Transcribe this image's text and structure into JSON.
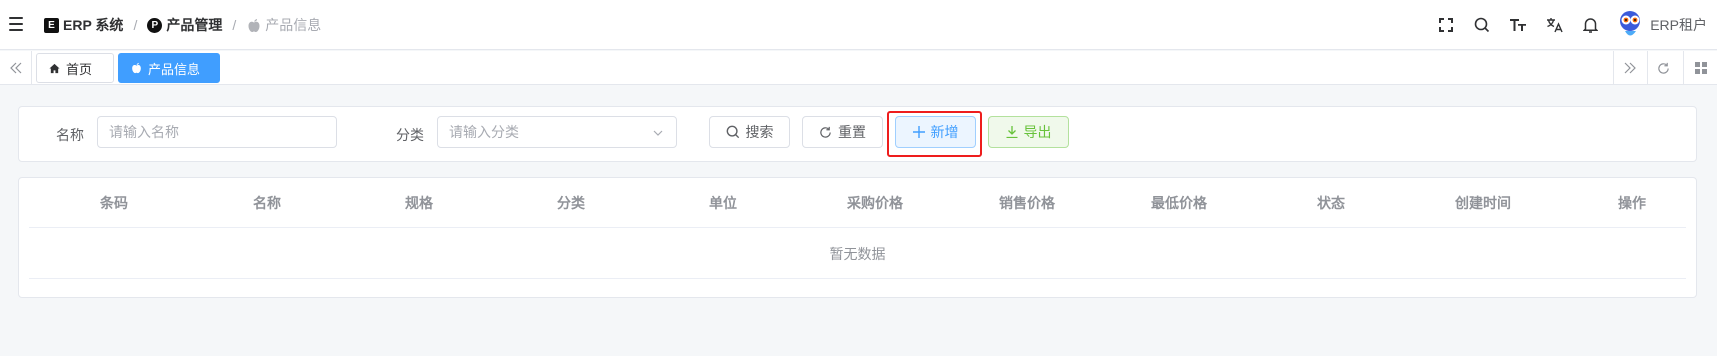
{
  "header": {
    "breadcrumbs": [
      {
        "label": "ERP 系统",
        "icon": "erp-logo-icon",
        "icon_char": "E"
      },
      {
        "label": "产品管理",
        "icon": "product-letter-icon",
        "icon_char": "P"
      },
      {
        "label": "产品信息",
        "icon": "apple-icon"
      }
    ],
    "separator": "/",
    "tools": [
      "fullscreen-icon",
      "search-icon",
      "font-size-icon",
      "translate-icon",
      "bell-icon"
    ],
    "username": "ERP租户"
  },
  "tabs": {
    "items": [
      {
        "label": "首页",
        "icon": "home-icon",
        "active": false
      },
      {
        "label": "产品信息",
        "icon": "apple-icon",
        "active": true
      }
    ]
  },
  "filters": {
    "name_label": "名称",
    "name_placeholder": "请输入名称",
    "category_label": "分类",
    "category_placeholder": "请输入分类"
  },
  "actions": {
    "search": "搜索",
    "reset": "重置",
    "add": "新增",
    "export": "导出"
  },
  "table": {
    "columns": [
      "条码",
      "名称",
      "规格",
      "分类",
      "单位",
      "采购价格",
      "销售价格",
      "最低价格",
      "状态",
      "创建时间",
      "操作"
    ],
    "empty_text": "暂无数据"
  },
  "colors": {
    "primary": "#409eff",
    "success": "#67c23a",
    "highlight": "#ee1d1d"
  }
}
